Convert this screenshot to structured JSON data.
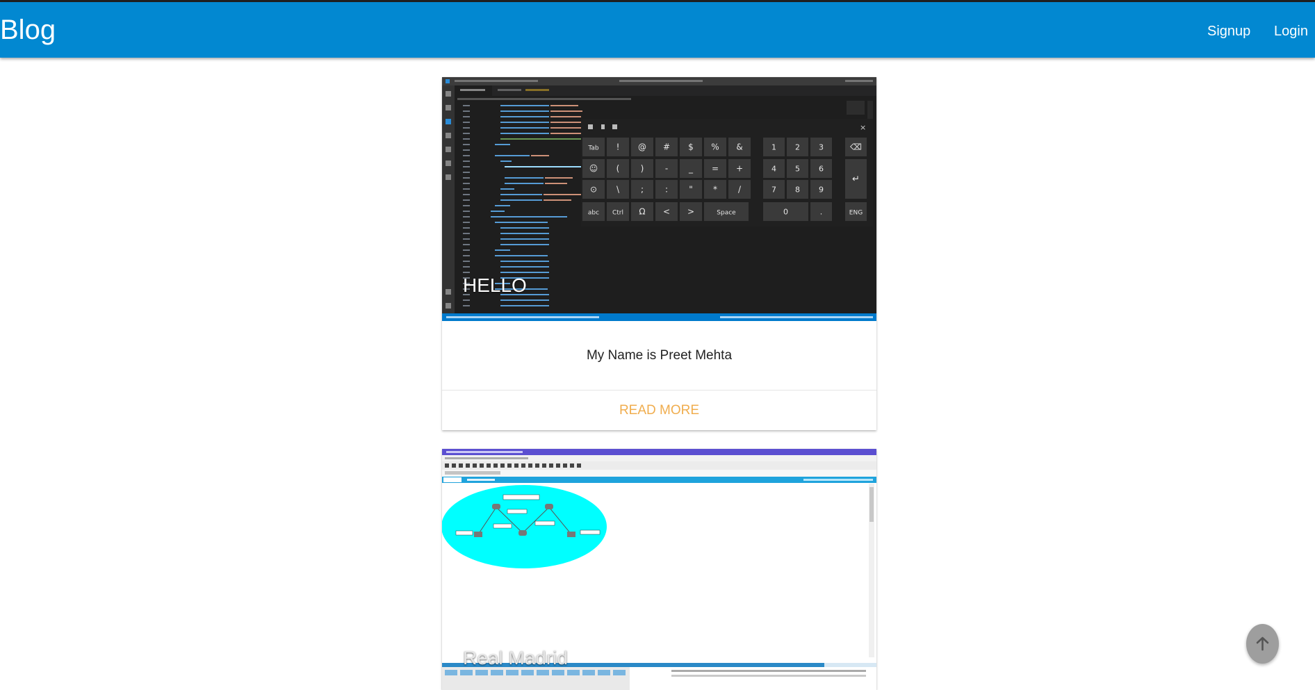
{
  "navbar": {
    "brand": "Blog",
    "signup": "Signup",
    "login": "Login",
    "color": "#0288d1"
  },
  "posts": [
    {
      "image_title": "HELLO",
      "content": "My Name is Preet Mehta",
      "action": "READ MORE"
    },
    {
      "image_title": "Real Madrid"
    }
  ],
  "editor_screenshot": {
    "keyboard_rows": [
      [
        "Tab",
        "!",
        "@",
        "#",
        "$",
        "%",
        "&"
      ],
      [
        "☺",
        "(",
        ")",
        "-",
        "_",
        "=",
        "+"
      ],
      [
        "⊙",
        "\\",
        ";",
        ":",
        "\"",
        "*",
        "/"
      ],
      [
        "abc",
        "Ctrl",
        "Ω",
        "<",
        ">",
        "Space"
      ]
    ],
    "numpad": [
      [
        "1",
        "2",
        "3"
      ],
      [
        "4",
        "5",
        "6"
      ],
      [
        "7",
        "8",
        "9"
      ],
      [
        "0",
        "."
      ]
    ],
    "side_keys": [
      "⌫",
      "↵",
      "ENG"
    ]
  },
  "fab": {
    "icon": "arrow-up-icon",
    "color": "#9e9e9e"
  },
  "accent_color": "#f0ad4e"
}
